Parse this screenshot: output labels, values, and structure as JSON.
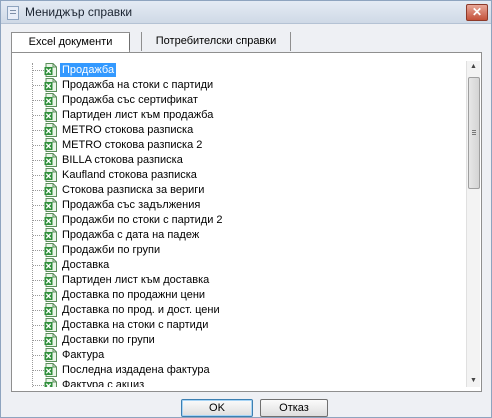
{
  "window": {
    "title": "Мениджър справки",
    "close_glyph": "✕"
  },
  "tabs": [
    {
      "label": "Excel документи",
      "active": true
    },
    {
      "label": "Потребителски справки",
      "active": false
    }
  ],
  "tree": {
    "item_icon": "excel-file-icon",
    "selected_index": 0,
    "items": [
      "Продажба",
      "Продажба на стоки с партиди",
      "Продажба със сертификат",
      "Партиден лист към продажба",
      "METRO стокова разписка",
      "METRO стокова разписка 2",
      "BILLA стокова разписка",
      "Kaufland стокова разписка",
      "Стокова разписка за вериги",
      "Продажба със задължения",
      "Продажби по стоки с партиди 2",
      "Продажба с дата на падеж",
      "Продажби по групи",
      "Доставка",
      "Партиден лист към доставка",
      "Доставка по продажни цени",
      "Доставка по прод. и дост. цени",
      "Доставка на стоки с партиди",
      "Доставки по групи",
      "Фактура",
      "Последна издадена фактура",
      "Фактура с акциз"
    ]
  },
  "buttons": {
    "ok": "OK",
    "cancel": "Отказ"
  },
  "colors": {
    "selection": "#3399ff",
    "icon_green": "#2f8f3a"
  }
}
